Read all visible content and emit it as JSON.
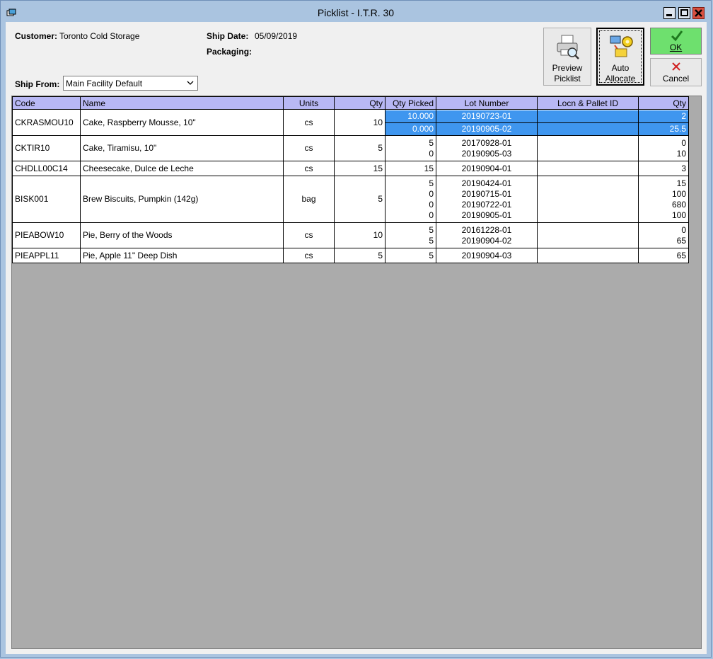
{
  "window": {
    "title": "Picklist - I.T.R. 30"
  },
  "header": {
    "customer_label": "Customer:",
    "customer_value": "Toronto Cold Storage",
    "ship_date_label": "Ship Date:",
    "ship_date_value": "05/09/2019",
    "packaging_label": "Packaging:",
    "ship_from_label": "Ship From:",
    "ship_from_value": "Main Facility Default"
  },
  "toolbar": {
    "preview_line1": "Preview",
    "preview_line2": "Picklist",
    "auto_line1": "Auto",
    "auto_line2": "Allocate",
    "ok_label": "OK",
    "cancel_label": "Cancel"
  },
  "grid": {
    "columns": [
      "Code",
      "Name",
      "Units",
      "Qty",
      "Qty Picked",
      "Lot Number",
      "Locn & Pallet ID",
      "Qty"
    ],
    "rows": [
      {
        "code": "CKRASMOU10",
        "name": "Cake, Raspberry Mousse, 10\"",
        "units": "cs",
        "qty": "10",
        "picked": [
          "10.000",
          "0.000"
        ],
        "lots": [
          "20190723-01",
          "20190905-02"
        ],
        "lot_qty": [
          "2",
          "25.5"
        ]
      },
      {
        "code": "CKTIR10",
        "name": "Cake, Tiramisu, 10\"",
        "units": "cs",
        "qty": "5",
        "picked": [
          "5",
          "0"
        ],
        "lots": [
          "20170928-01",
          "20190905-03"
        ],
        "lot_qty": [
          "0",
          "10"
        ]
      },
      {
        "code": "CHDLL00C14",
        "name": "Cheesecake, Dulce de Leche",
        "units": "cs",
        "qty": "15",
        "picked": [
          "15"
        ],
        "lots": [
          "20190904-01"
        ],
        "lot_qty": [
          "3"
        ]
      },
      {
        "code": "BISK001",
        "name": "Brew Biscuits, Pumpkin (142g)",
        "units": "bag",
        "qty": "5",
        "picked": [
          "5",
          "0",
          "0",
          "0"
        ],
        "lots": [
          "20190424-01",
          "20190715-01",
          "20190722-01",
          "20190905-01"
        ],
        "lot_qty": [
          "15",
          "100",
          "680",
          "100"
        ]
      },
      {
        "code": "PIEABOW10",
        "name": "Pie, Berry of the Woods",
        "units": "cs",
        "qty": "10",
        "picked": [
          "5",
          "5"
        ],
        "lots": [
          "20161228-01",
          "20190904-02"
        ],
        "lot_qty": [
          "0",
          "65"
        ]
      },
      {
        "code": "PIEAPPL11",
        "name": "Pie, Apple 11\" Deep Dish",
        "units": "cs",
        "qty": "5",
        "picked": [
          "5"
        ],
        "lots": [
          "20190904-03"
        ],
        "lot_qty": [
          "65"
        ]
      }
    ]
  },
  "colors": {
    "selection": "#3f96ef",
    "header_bg": "#b8b8f4",
    "ok_bg": "#6ee06e"
  }
}
